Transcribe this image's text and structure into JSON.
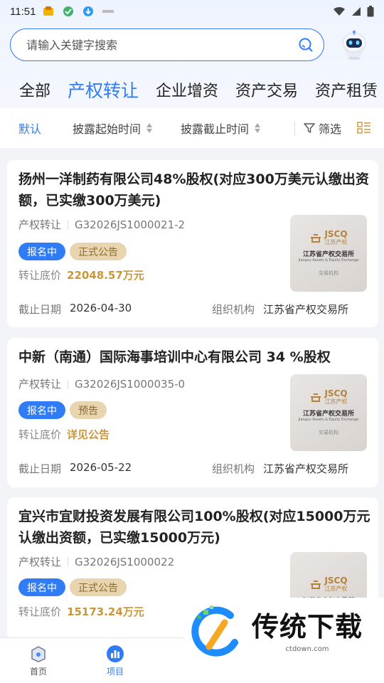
{
  "status_bar": {
    "time": "11:51",
    "app_icons": [
      "shop-icon",
      "shield-app-icon",
      "download-app-icon",
      "crystal-app-icon"
    ],
    "right_icons": [
      "wifi-icon",
      "signal-icon",
      "battery-icon"
    ]
  },
  "search": {
    "placeholder": "请输入关键字搜索"
  },
  "tabs": [
    {
      "label": "全部",
      "active": false
    },
    {
      "label": "产权转让",
      "active": true
    },
    {
      "label": "企业增资",
      "active": false
    },
    {
      "label": "资产交易",
      "active": false
    },
    {
      "label": "资产租赁",
      "active": false
    }
  ],
  "filters": {
    "default": "默认",
    "start_time": "披露起始时间",
    "end_time": "披露截止时间",
    "filter": "筛选"
  },
  "labels": {
    "price": "转让底价",
    "deadline": "截止日期",
    "org": "组织机构"
  },
  "thumb": {
    "code": "JSCQ",
    "sub": "江苏产权",
    "name": "江苏省产权交易所",
    "tiny": "Jiangsu Assets & Equity Exchange",
    "tag": "交易机构"
  },
  "listings": [
    {
      "title": "扬州一洋制药有限公司48%股权(对应300万美元认缴出资额，已实缴300万美元)",
      "type": "产权转让",
      "code": "G32026JS1000021-2",
      "status": "报名中",
      "notice": "正式公告",
      "price": "22048.57万元",
      "deadline": "2026-04-30",
      "org": "江苏省产权交易所"
    },
    {
      "title": "中新（南通）国际海事培训中心有限公司 34 %股权",
      "type": "产权转让",
      "code": "G32026JS1000035-0",
      "status": "报名中",
      "notice": "预告",
      "price": "详见公告",
      "deadline": "2026-05-22",
      "org": "江苏省产权交易所"
    },
    {
      "title": "宜兴市宜财投资发展有限公司100%股权(对应15000万元认缴出资额，已实缴15000万元)",
      "type": "产权转让",
      "code": "G32026JS1000022",
      "status": "报名中",
      "notice": "正式公告",
      "price": "15173.24万元",
      "deadline": "",
      "org": ""
    }
  ],
  "bottom_nav": [
    {
      "label": "首页",
      "icon": "home-icon",
      "active": false
    },
    {
      "label": "项目",
      "icon": "bar-chart-icon",
      "active": true
    }
  ],
  "watermark": {
    "text": "传统下载",
    "url": "ctdown.com"
  },
  "colors": {
    "accent": "#2f7cf6",
    "price": "#c9963b",
    "badge_gold": "#e8d5b0"
  }
}
